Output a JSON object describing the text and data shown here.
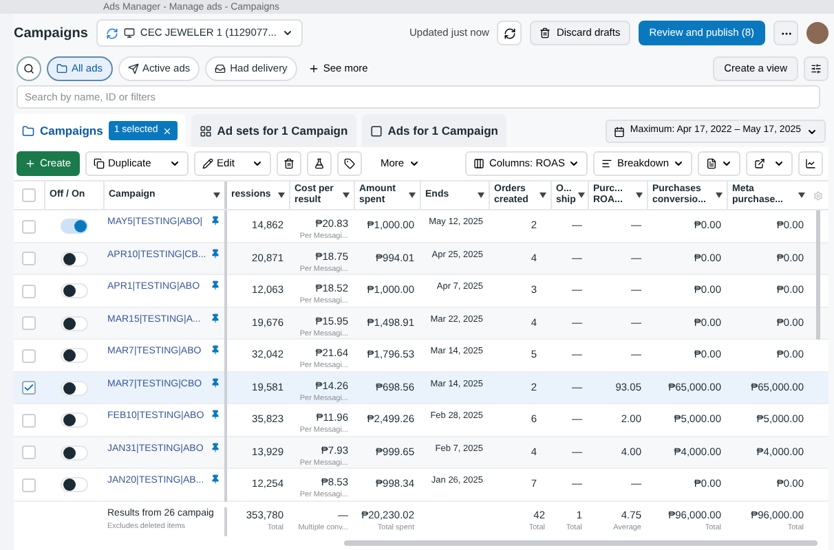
{
  "browser": {
    "title": "Ads Manager - Manage ads - Campaigns"
  },
  "header": {
    "title": "Campaigns",
    "account": "CEC JEWELER 1 (1129077...",
    "updated": "Updated just now",
    "discard": "Discard drafts",
    "publish": "Review and publish (8)"
  },
  "filters": [
    {
      "label": "All ads",
      "selected": true
    },
    {
      "label": "Active ads",
      "selected": false
    },
    {
      "label": "Had delivery",
      "selected": false
    }
  ],
  "see_more": "See more",
  "create_view": "Create a view",
  "search": {
    "placeholder": "Search by name, ID or filters"
  },
  "tabs": [
    {
      "label": "Campaigns",
      "selected": true,
      "badge": "1 selected"
    },
    {
      "label": "Ad sets for 1 Campaign",
      "selected": false
    },
    {
      "label": "Ads for 1 Campaign",
      "selected": false
    }
  ],
  "date_range": "Maximum: Apr 17, 2022 – May 17, 2025",
  "toolbar": {
    "create": "Create",
    "duplicate": "Duplicate",
    "edit": "Edit",
    "more": "More",
    "columns": "Columns: ROAS",
    "breakdown": "Breakdown"
  },
  "table": {
    "select_all": {
      "checked": false
    },
    "columns": [
      "Off / On",
      "Campaign",
      "ressions",
      "Cost per result",
      "Amount spent",
      "Ends",
      "Orders created",
      "O... ship",
      "Purc... ROA...",
      "Purchases conversio...",
      "Meta purchase..."
    ],
    "rows": [
      {
        "selected": false,
        "on": true,
        "name": "MAY5|TESTING|ABO|",
        "impressions": "14,862",
        "cost": "₱20.83",
        "cost_note": "Per Messagi...",
        "amount": "₱1,000.00",
        "ends": "May 12, 2025",
        "orders": "2",
        "ship": "—",
        "roa": "—",
        "purchases": "₱0.00",
        "meta": "₱0.00"
      },
      {
        "selected": false,
        "on": false,
        "name": "APR10|TESTING|CB...",
        "impressions": "20,871",
        "cost": "₱18.75",
        "cost_note": "Per Messagi...",
        "amount": "₱994.01",
        "ends": "Apr 25, 2025",
        "orders": "4",
        "ship": "—",
        "roa": "—",
        "purchases": "₱0.00",
        "meta": "₱0.00"
      },
      {
        "selected": false,
        "on": false,
        "name": "APR1|TESTING|ABO",
        "impressions": "12,063",
        "cost": "₱18.52",
        "cost_note": "Per Messagi...",
        "amount": "₱1,000.00",
        "ends": "Apr 7, 2025",
        "orders": "3",
        "ship": "—",
        "roa": "—",
        "purchases": "₱0.00",
        "meta": "₱0.00"
      },
      {
        "selected": false,
        "on": false,
        "name": "MAR15|TESTING|A...",
        "impressions": "19,676",
        "cost": "₱15.95",
        "cost_note": "Per Messagi...",
        "amount": "₱1,498.91",
        "ends": "Mar 22, 2025",
        "orders": "4",
        "ship": "—",
        "roa": "—",
        "purchases": "₱0.00",
        "meta": "₱0.00"
      },
      {
        "selected": false,
        "on": false,
        "name": "MAR7|TESTING|ABO",
        "impressions": "32,042",
        "cost": "₱21.64",
        "cost_note": "Per Messagi...",
        "amount": "₱1,796.53",
        "ends": "Mar 14, 2025",
        "orders": "5",
        "ship": "—",
        "roa": "—",
        "purchases": "₱0.00",
        "meta": "₱0.00"
      },
      {
        "selected": true,
        "on": false,
        "name": "MAR7|TESTING|CBO",
        "impressions": "19,581",
        "cost": "₱14.26",
        "cost_note": "Per Messagi...",
        "amount": "₱698.56",
        "ends": "Mar 14, 2025",
        "orders": "2",
        "ship": "—",
        "roa": "93.05",
        "purchases": "₱65,000.00",
        "meta": "₱65,000.00"
      },
      {
        "selected": false,
        "on": false,
        "name": "FEB10|TESTING|ABO",
        "impressions": "35,823",
        "cost": "₱11.96",
        "cost_note": "Per Messagi...",
        "amount": "₱2,499.26",
        "ends": "Feb 28, 2025",
        "orders": "6",
        "ship": "—",
        "roa": "2.00",
        "purchases": "₱5,000.00",
        "meta": "₱5,000.00"
      },
      {
        "selected": false,
        "on": false,
        "name": "JAN31|TESTING|ABO",
        "impressions": "13,929",
        "cost": "₱7.93",
        "cost_note": "Per Messagi...",
        "amount": "₱999.65",
        "ends": "Feb 7, 2025",
        "orders": "4",
        "ship": "—",
        "roa": "4.00",
        "purchases": "₱4,000.00",
        "meta": "₱4,000.00"
      },
      {
        "selected": false,
        "on": false,
        "name": "JAN20|TESTING|AB...",
        "impressions": "12,254",
        "cost": "₱8.53",
        "cost_note": "Per Messagi...",
        "amount": "₱998.34",
        "ends": "Jan 26, 2025",
        "orders": "7",
        "ship": "—",
        "roa": "—",
        "purchases": "₱0.00",
        "meta": "₱0.00"
      }
    ],
    "totals": {
      "label": "Results from 26 campaig",
      "note": "Excludes deleted items",
      "impressions": "353,780",
      "impressions_note": "Total",
      "cost": "—",
      "cost_note": "Multiple conv...",
      "amount": "₱20,230.02",
      "amount_note": "Total spent",
      "orders": "42",
      "orders_note": "Total",
      "ship": "1",
      "ship_note": "Total",
      "roa": "4.75",
      "roa_note": "Average",
      "purchases": "₱96,000.00",
      "purchases_note": "Total",
      "meta": "₱96,000.00",
      "meta_note": "Total"
    }
  }
}
